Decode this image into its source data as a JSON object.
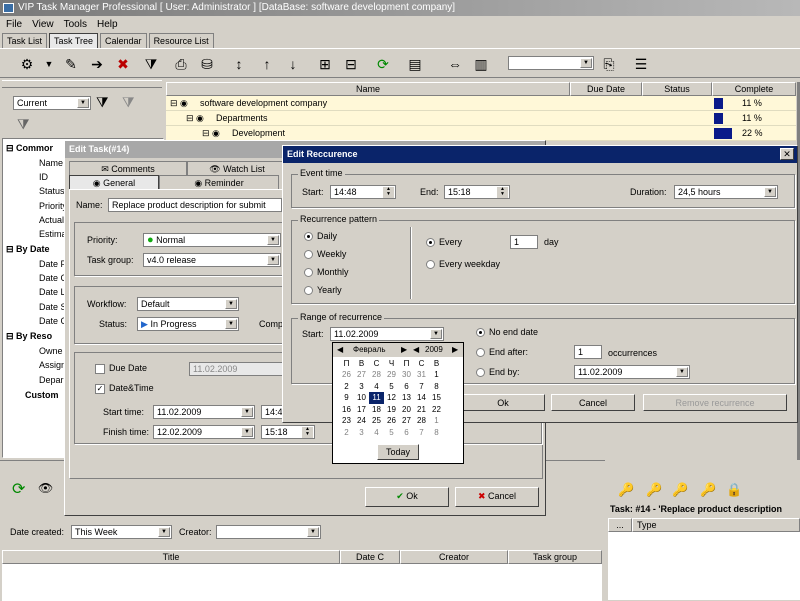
{
  "app": {
    "title": "VIP Task Manager Professional [ User: Administrator ] [DataBase: software development company]"
  },
  "menu": [
    "File",
    "View",
    "Tools",
    "Help"
  ],
  "tabs": [
    "Task List",
    "Task Tree",
    "Calendar",
    "Resource List"
  ],
  "left_panel": {
    "filter": "Current",
    "sections": [
      {
        "title": "Commor",
        "items": [
          "Name",
          "ID",
          "Status",
          "Priority",
          "Actual",
          "Estima"
        ]
      },
      {
        "title": "By Date",
        "items": [
          "Date F",
          "Date C",
          "Date L",
          "Date S",
          "Date C"
        ]
      },
      {
        "title": "By Reso",
        "items": [
          "Owne",
          "Assign",
          "Depar"
        ]
      }
    ],
    "custom": "Custom"
  },
  "tree": {
    "columns": [
      "Name",
      "Due Date",
      "Status",
      "Complete"
    ],
    "rows": [
      {
        "name": "software development company",
        "complete": "11 %",
        "pct": 11
      },
      {
        "name": "Departments",
        "complete": "11 %",
        "pct": 11
      },
      {
        "name": "Development",
        "complete": "22 %",
        "pct": 22
      }
    ]
  },
  "edit_task": {
    "title": "Edit Task(#14)",
    "tabs_top": [
      "Comments",
      "Watch List"
    ],
    "tabs_bottom": [
      "General",
      "Reminder"
    ],
    "name_label": "Name:",
    "name_value": "Replace product description for submit",
    "priority_label": "Priority:",
    "priority_value": "Normal",
    "group_label": "Task group:",
    "group_value": "v4.0 release",
    "workflow_label": "Workflow:",
    "workflow_value": "Default",
    "status_label": "Status:",
    "status_value": "In Progress",
    "complete_label": "Comple",
    "due_label": "Due Date",
    "due_value": "11.02.2009",
    "datetime_label": "Date&Time",
    "start_label": "Start time:",
    "start_date": "11.02.2009",
    "start_time": "14:48",
    "finish_label": "Finish time:",
    "finish_date": "12.02.2009",
    "finish_time": "15:18",
    "ok": "Ok",
    "cancel": "Cancel"
  },
  "recurrence": {
    "title": "Edit Reccurence",
    "event_time": "Event time",
    "start_label": "Start:",
    "start": "14:48",
    "end_label": "End:",
    "end": "15:18",
    "duration_label": "Duration:",
    "duration": "24,5 hours",
    "pattern_label": "Recurrence pattern",
    "patterns": [
      "Daily",
      "Weekly",
      "Monthly",
      "Yearly"
    ],
    "every_label": "Every",
    "every_value": "1",
    "day_label": "day",
    "every_weekday": "Every weekday",
    "range_label": "Range of recurrence",
    "range_start_label": "Start:",
    "range_start": "11.02.2009",
    "no_end": "No end date",
    "end_after": "End after:",
    "end_after_value": "1",
    "occurrences": "occurrences",
    "end_by": "End by:",
    "end_by_value": "11.02.2009",
    "ok": "Ok",
    "cancel": "Cancel",
    "remove": "Remove recurrence"
  },
  "calendar": {
    "month": "Февраль",
    "year": "2009",
    "weekdays": [
      "П",
      "В",
      "С",
      "Ч",
      "П",
      "С",
      "В"
    ],
    "weeks": [
      [
        "26",
        "27",
        "28",
        "29",
        "30",
        "31",
        "1"
      ],
      [
        "2",
        "3",
        "4",
        "5",
        "6",
        "7",
        "8"
      ],
      [
        "9",
        "10",
        "11",
        "12",
        "13",
        "14",
        "15"
      ],
      [
        "16",
        "17",
        "18",
        "19",
        "20",
        "21",
        "22"
      ],
      [
        "23",
        "24",
        "25",
        "26",
        "27",
        "28",
        "1"
      ],
      [
        "2",
        "3",
        "4",
        "5",
        "6",
        "7",
        "8"
      ]
    ],
    "today": "Today"
  },
  "bottom": {
    "date_created_label": "Date created:",
    "date_created": "This Week",
    "creator_label": "Creator:",
    "columns": [
      "Title",
      "Date C",
      "Creator",
      "Task group"
    ]
  },
  "right_panel": {
    "task_title": "Task: #14 - 'Replace product description",
    "col_dots": "...",
    "col_type": "Type"
  }
}
